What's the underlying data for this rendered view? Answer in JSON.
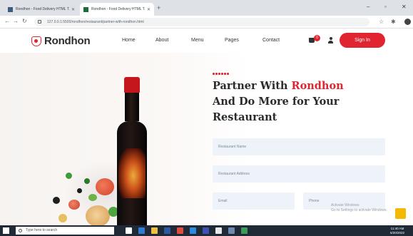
{
  "browser": {
    "tabs": [
      {
        "title": "Rondhon - Food Delivery HTML T..."
      },
      {
        "title": "Rondhon - Food Delivery HTML T..."
      }
    ],
    "new_tab_glyph": "+",
    "url": "127.0.0.1:5500/rondhon/restaurant/partner-with-rondhon.html"
  },
  "site": {
    "logo_text": "Rondhon",
    "nav": [
      "Home",
      "About",
      "Menu",
      "Pages",
      "Contact"
    ],
    "cart_count": "0",
    "signin_label": "Sign In"
  },
  "hero": {
    "title_prefix": "Partner With ",
    "title_accent": "Rondhon",
    "title_line2": "And Do More for Your",
    "title_line3": "Restaurant",
    "fields": {
      "restaurant_name": "Restaurant Name",
      "restaurant_address": "Restaurant Address",
      "email": "Email",
      "phone": "Phone"
    }
  },
  "watermark": {
    "line1": "Activate Windows",
    "line2": "Go to Settings to activate Windows."
  },
  "taskbar": {
    "search_placeholder": "Type here to search",
    "time": "11:40 AM",
    "date": "5/20/2022"
  },
  "colors": {
    "brand_red": "#e02531",
    "field_bg": "#edf3f8",
    "taskbar_bg": "#1f2a36"
  },
  "icons": [
    "windows-icon",
    "search-icon",
    "cart-icon",
    "user-icon",
    "lock-icon",
    "chat-icon"
  ]
}
